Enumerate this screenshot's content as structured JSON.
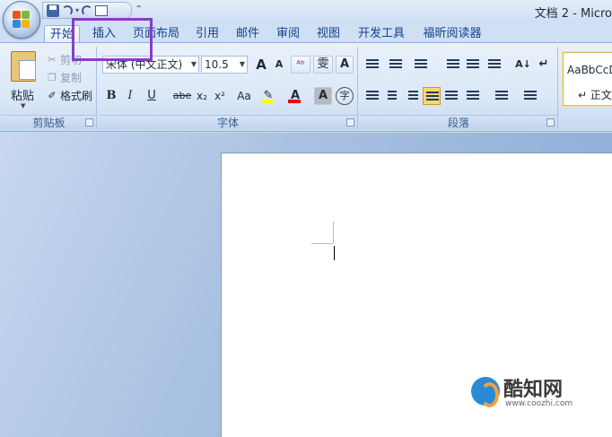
{
  "window": {
    "title": "文档 2 - Micro"
  },
  "qat": {
    "more": "⁼"
  },
  "tabs": [
    {
      "label": "开始",
      "active": true
    },
    {
      "label": "插入"
    },
    {
      "label": "页面布局"
    },
    {
      "label": "引用"
    },
    {
      "label": "邮件"
    },
    {
      "label": "审阅"
    },
    {
      "label": "视图"
    },
    {
      "label": "开发工具"
    },
    {
      "label": "福昕阅读器"
    }
  ],
  "clipboard": {
    "paste": "粘贴",
    "cut": "剪切",
    "copy": "复制",
    "format_painter": "格式刷",
    "group_label": "剪贴板"
  },
  "font": {
    "font_name": "宋体 (中文正文)",
    "font_size": "10.5",
    "grow": "A",
    "shrink": "A",
    "clear": "ᴬᵇ",
    "phonetic": "雯",
    "border_char": "A",
    "bold": "B",
    "italic": "I",
    "underline": "U",
    "strike": "abe",
    "sub": "x₂",
    "sup": "x²",
    "change_case": "Aa",
    "highlight": "✎",
    "font_color": "A",
    "shade_char": "A",
    "enclose": "字",
    "group_label": "字体"
  },
  "paragraph": {
    "group_label": "段落",
    "sort": "A↓",
    "marks": "↵"
  },
  "styles": {
    "sample": "AaBbCcD",
    "name": "↵ 正文"
  },
  "colors": {
    "highlight": "#ffff00",
    "font_color": "#e3001b",
    "annotation": "#8a3cc7"
  },
  "watermark": {
    "brand": "酷知网",
    "url": "www.coozhi.com"
  }
}
